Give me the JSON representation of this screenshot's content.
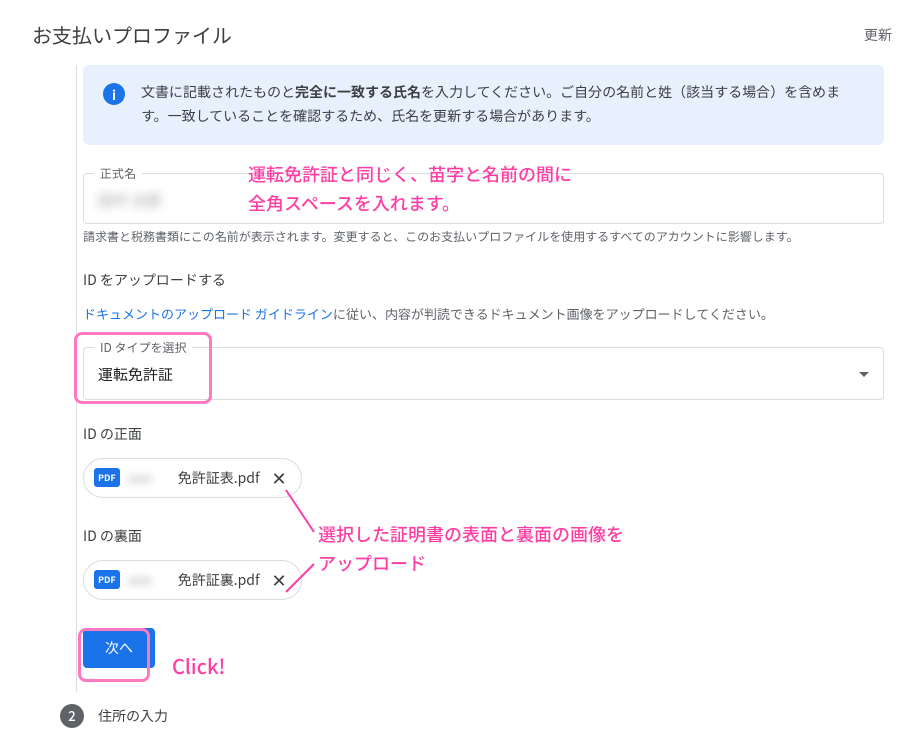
{
  "header": {
    "title": "お支払いプロファイル",
    "update_link": "更新"
  },
  "info": {
    "text_before_bold": "文書に記載されたものと",
    "text_bold": "完全に一致する氏名",
    "text_after_bold": "を入力してください。ご自分の名前と姓（該当する場合）を含めます。一致していることを確認するため、氏名を更新する場合があります。"
  },
  "legal_name": {
    "label": "正式名",
    "value": "田中 太郎",
    "helper": "請求書と税務書類にこの名前が表示されます。変更すると、このお支払いプロファイルを使用するすべてのアカウントに影響します。"
  },
  "upload": {
    "title": "ID をアップロードする",
    "guideline_link": "ドキュメントのアップロード ガイドライン",
    "guideline_text": "に従い、内容が判読できるドキュメント画像をアップロードしてください。"
  },
  "id_type": {
    "label": "ID タイプを選択",
    "value": "運転免許証"
  },
  "id_front": {
    "label": "ID の正面",
    "file_badge": "PDF",
    "file_name": "免許証表.pdf"
  },
  "id_back": {
    "label": "ID の裏面",
    "file_badge": "PDF",
    "file_name": "免許証裏.pdf"
  },
  "actions": {
    "next_label": "次へ"
  },
  "step2": {
    "number": "2",
    "label": "住所の入力"
  },
  "annotations": {
    "name_hint_line1": "運転免許証と同じく、苗字と名前の間に",
    "name_hint_line2": "全角スペースを入れます。",
    "upload_hint_line1": "選択した証明書の表面と裏面の画像を",
    "upload_hint_line2": "アップロード",
    "click_label": "Click!"
  }
}
